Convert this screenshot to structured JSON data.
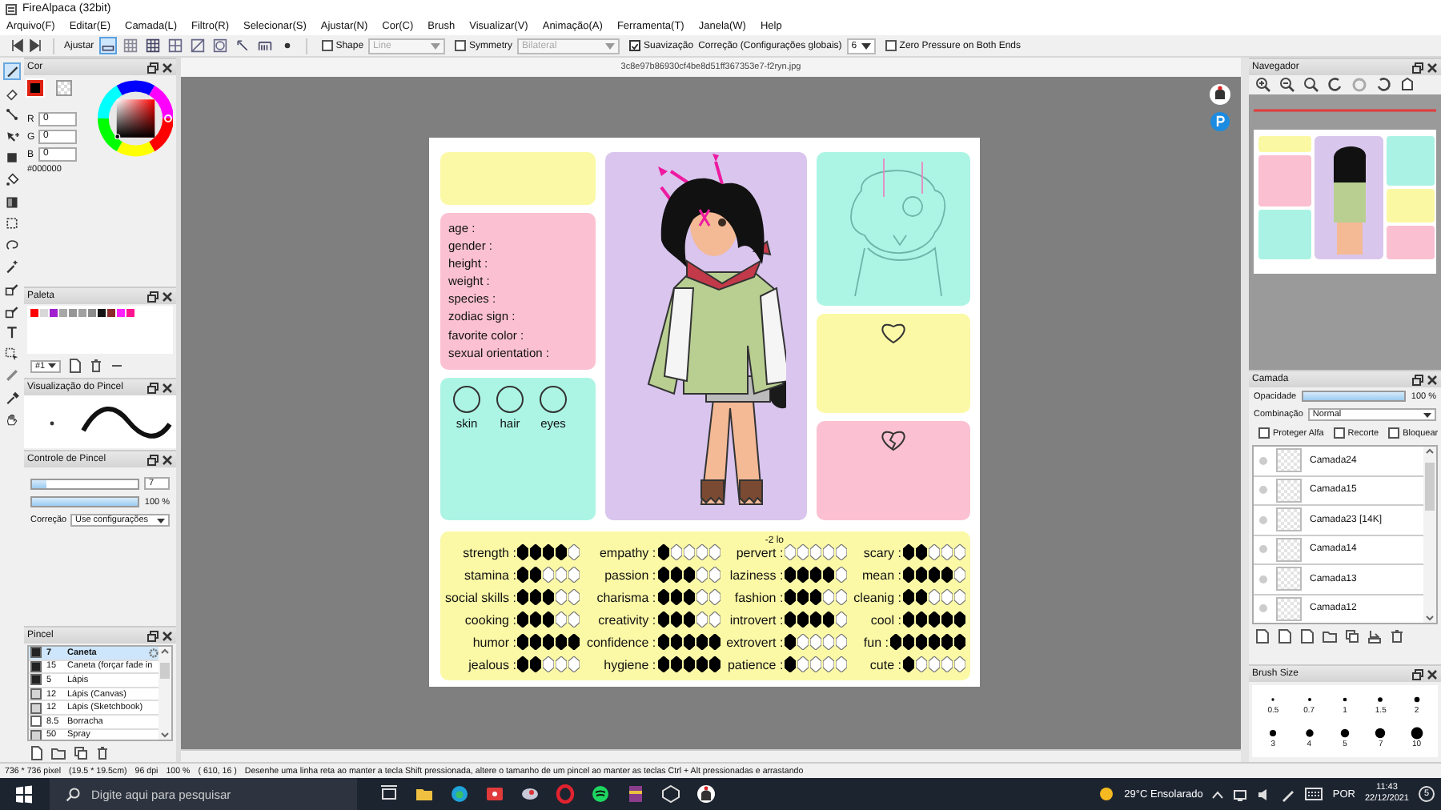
{
  "window": {
    "title": "FireAlpaca (32bit)"
  },
  "menu": [
    "Arquivo(F)",
    "Editar(E)",
    "Camada(L)",
    "Filtro(R)",
    "Selecionar(S)",
    "Ajustar(N)",
    "Cor(C)",
    "Brush",
    "Visualizar(V)",
    "Animação(A)",
    "Ferramenta(T)",
    "Janela(W)",
    "Help"
  ],
  "toolbar": {
    "snap_label": "Ajustar",
    "snap_modes": [
      {
        "selected": true
      },
      {
        "selected": false
      },
      {
        "selected": false
      },
      {
        "selected": false
      },
      {
        "selected": false
      },
      {
        "selected": false
      },
      {
        "selected": false
      },
      {
        "selected": false
      },
      {
        "selected": false
      }
    ],
    "shape": {
      "label": "Shape",
      "checked": false,
      "value": "Line"
    },
    "symmetry": {
      "label": "Symmetry",
      "checked": false,
      "value": "Bilateral"
    },
    "smoothing": {
      "label": "Suavização",
      "checked": true
    },
    "correction": {
      "label": "Correção (Configurações globais)",
      "value": "6"
    },
    "zero_pressure": {
      "label": "Zero Pressure on Both Ends",
      "checked": false
    }
  },
  "tools": [
    {
      "kind": "pen",
      "selected": true
    },
    {
      "kind": "eraser",
      "selected": false
    },
    {
      "kind": "dotline",
      "selected": false
    },
    {
      "kind": "move",
      "selected": false
    },
    {
      "kind": "fill",
      "selected": false
    },
    {
      "kind": "bucket",
      "selected": false
    },
    {
      "kind": "gradient",
      "selected": false
    },
    {
      "kind": "select",
      "selected": false
    },
    {
      "kind": "lasso",
      "selected": false
    },
    {
      "kind": "wand",
      "selected": false
    },
    {
      "kind": "selpen",
      "selected": false
    },
    {
      "kind": "selpen",
      "selected": false
    },
    {
      "kind": "text",
      "selected": false
    },
    {
      "kind": "operate",
      "selected": false
    },
    {
      "kind": "divide",
      "selected": false
    },
    {
      "kind": "dropper",
      "selected": false
    },
    {
      "kind": "hand",
      "selected": false
    }
  ],
  "color_panel": {
    "title": "Cor",
    "fields": [
      {
        "label": "R",
        "value": "0"
      },
      {
        "label": "G",
        "value": "0"
      },
      {
        "label": "B",
        "value": "0"
      }
    ],
    "hex": "#000000",
    "color": "#000000"
  },
  "palette_panel": {
    "title": "Paleta",
    "swatches": [
      {
        "color": "#ff0000"
      },
      {
        "color": "#d8d8d8"
      },
      {
        "color": "#a020d0"
      },
      {
        "color": "#a8a8a8"
      },
      {
        "color": "#969696"
      },
      {
        "color": "#a0a0a0"
      },
      {
        "color": "#8c8c8c"
      },
      {
        "color": "#141414"
      },
      {
        "color": "#8b2a2a"
      },
      {
        "color": "#ff22ff"
      },
      {
        "color": "#ff1490"
      }
    ],
    "set": "#1"
  },
  "brush_preview": {
    "title": "Visualização do Pincel"
  },
  "brush_control": {
    "title": "Controle de Pincel",
    "size_slider": {
      "level": 0.14
    },
    "size": "7",
    "opacity_slider": {
      "level": 1.0
    },
    "opacity": "100 %",
    "correction_label": "Correção",
    "correction": "Use configurações"
  },
  "brush_panel": {
    "title": "Pincel",
    "items": [
      {
        "size": "7",
        "name": "Caneta",
        "color": "#222222",
        "selected": true
      },
      {
        "size": "15",
        "name": "Caneta (forçar fade in",
        "color": "#222222",
        "selected": false
      },
      {
        "size": "5",
        "name": "Lápis",
        "color": "#222222",
        "selected": false
      },
      {
        "size": "12",
        "name": "Lápis (Canvas)",
        "color": "#d4d4d4",
        "selected": false
      },
      {
        "size": "12",
        "name": "Lápis (Sketchbook)",
        "color": "#d4d4d4",
        "selected": false
      },
      {
        "size": "8.5",
        "name": "Borracha",
        "color": "#ffffff",
        "selected": false
      },
      {
        "size": "50",
        "name": "Spray",
        "color": "#d4d4d4",
        "selected": false
      }
    ]
  },
  "document": {
    "title": "3c8e97b86930cf4be8d51ff367353e7-f2ryn.jpg",
    "info_fields": [
      "age :",
      "gender :",
      "height :",
      "weight :",
      "species :",
      "zodiac sign :",
      "favorite color :",
      "sexual orientation :"
    ],
    "color_circles": [
      "skin",
      "hair",
      "eyes"
    ],
    "stat_columns": [
      [
        {
          "label": "strength :",
          "stars": 4
        },
        {
          "label": "stamina :",
          "stars": 2
        },
        {
          "label": "social skills :",
          "stars": 3
        },
        {
          "label": "cooking :",
          "stars": 3
        },
        {
          "label": "humor :",
          "stars": 5
        },
        {
          "label": "jealous :",
          "stars": 2
        }
      ],
      [
        {
          "label": "empathy :",
          "stars": 1
        },
        {
          "label": "passion :",
          "stars": 3
        },
        {
          "label": "charisma :",
          "stars": 3
        },
        {
          "label": "creativity :",
          "stars": 3
        },
        {
          "label": "confidence :",
          "stars": 5
        },
        {
          "label": "hygiene :",
          "stars": 5
        }
      ],
      [
        {
          "label": "pervert :",
          "stars": 0,
          "note": "-2 lo"
        },
        {
          "label": "laziness :",
          "stars": 4
        },
        {
          "label": "fashion :",
          "stars": 3
        },
        {
          "label": "introvert :",
          "stars": 4
        },
        {
          "label": "extrovert :",
          "stars": 1
        },
        {
          "label": "patience :",
          "stars": 1
        }
      ],
      [
        {
          "label": "scary :",
          "stars": 2
        },
        {
          "label": "mean :",
          "stars": 4
        },
        {
          "label": "cleanig :",
          "stars": 2
        },
        {
          "label": "cool :",
          "stars": 5
        },
        {
          "label": "fun :",
          "stars": 6
        },
        {
          "label": "cute :",
          "stars": 1
        }
      ]
    ]
  },
  "navigator": {
    "title": "Navegador"
  },
  "layer_panel": {
    "title": "Camada",
    "opacity_label": "Opacidade",
    "opacity_slider": {
      "level": 1.0
    },
    "opacity": "100 %",
    "blend_label": "Combinação",
    "blend": "Normal",
    "options": [
      {
        "label": "Proteger Alfa",
        "checked": false
      },
      {
        "label": "Recorte",
        "checked": false
      },
      {
        "label": "Bloquear",
        "checked": false
      }
    ],
    "layers": [
      "Camada24",
      "Camada15",
      "Camada23 [14K]",
      "Camada14",
      "Camada13",
      "Camada12"
    ]
  },
  "brush_size_panel": {
    "title": "Brush Size",
    "sizes": [
      "0.5",
      "0.7",
      "1",
      "1.5",
      "2",
      "3",
      "4",
      "5",
      "7",
      "10"
    ]
  },
  "status_bar": [
    "736 * 736 pixel",
    "(19.5 * 19.5cm)",
    "96 dpi",
    "100 %",
    "( 610, 16 )",
    "Desenhe uma linha reta ao manter a tecla Shift pressionada, altere o tamanho de um pincel ao manter as teclas Ctrl + Alt pressionadas e arrastando"
  ],
  "taskbar": {
    "search_placeholder": "Digite aqui para pesquisar",
    "weather": "29°C  Ensolarado",
    "language": "POR",
    "time": "11:43",
    "date": "22/12/2021",
    "notifications": "5"
  }
}
